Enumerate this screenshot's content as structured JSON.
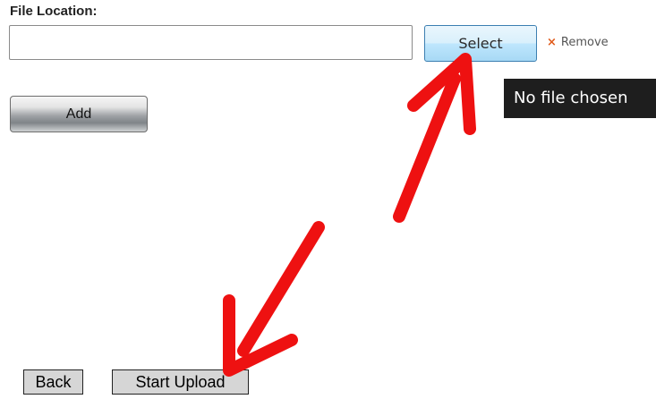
{
  "form": {
    "file_location_label": "File Location:",
    "file_input_value": "",
    "select_label": "Select",
    "remove_label": "Remove",
    "remove_icon": "×",
    "tooltip_text": "No file chosen",
    "add_label": "Add"
  },
  "footer": {
    "back_label": "Back",
    "start_upload_label": "Start Upload"
  },
  "annotation": {
    "arrow_color": "#ee1111",
    "arrow_icon": "double-headed-arrow"
  }
}
